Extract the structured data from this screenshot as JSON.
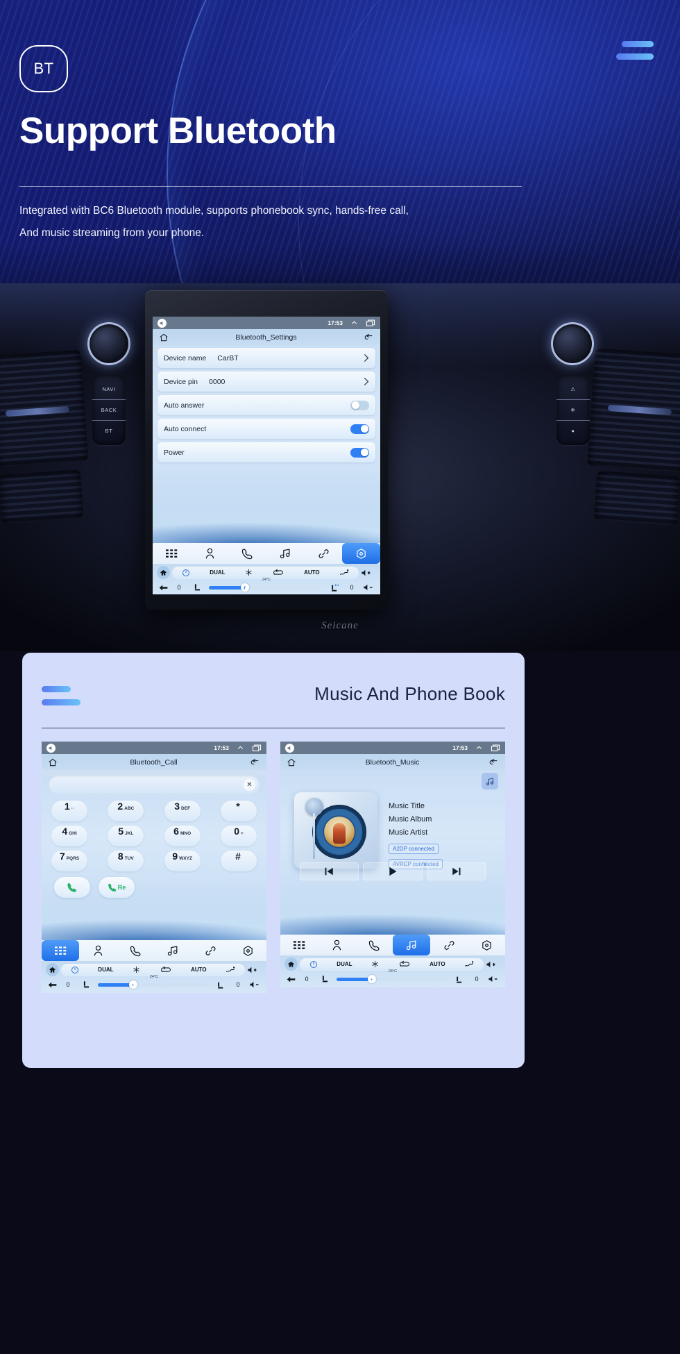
{
  "hero": {
    "badge": "BT",
    "title": "Support Bluetooth",
    "subtitle_line1": "Integrated with BC6 Bluetooth module, supports phonebook sync, hands-free call,",
    "subtitle_line2": "And music streaming from your phone.",
    "accent_from": "#5a7af0",
    "accent_to": "#69c2f7",
    "background": "#141b6e"
  },
  "dash": {
    "brand": "Seicane",
    "left_keys": [
      "NAVI",
      "BACK",
      "BT"
    ],
    "right_keys": [
      "⚠",
      "❄",
      "●"
    ]
  },
  "main_screen": {
    "statusbar": {
      "time": "17:53",
      "chevron_icon": "chevron-up-icon",
      "recents_icon": "recents-icon",
      "volume_icon": "volume-icon"
    },
    "titlebar": {
      "home_icon": "home-icon",
      "title": "Bluetooth_Settings",
      "back_icon": "back-arrow-icon"
    },
    "rows": [
      {
        "label": "Device name",
        "value": "CarBT",
        "control": "chevron"
      },
      {
        "label": "Device pin",
        "value": "0000",
        "control": "chevron"
      },
      {
        "label": "Auto answer",
        "value": "",
        "control": "toggle",
        "on": false
      },
      {
        "label": "Auto connect",
        "value": "",
        "control": "toggle",
        "on": true
      },
      {
        "label": "Power",
        "value": "",
        "control": "toggle",
        "on": true
      }
    ],
    "dock": [
      {
        "icon": "apps-grid-icon",
        "active": false
      },
      {
        "icon": "contact-icon",
        "active": false
      },
      {
        "icon": "phone-icon",
        "active": false
      },
      {
        "icon": "music-note-icon",
        "active": false
      },
      {
        "icon": "link-icon",
        "active": false
      },
      {
        "icon": "settings-icon",
        "active": true
      }
    ],
    "climate": {
      "home_icon": "home-icon",
      "power_icon": "power-icon",
      "dual_label": "DUAL",
      "snowflake_icon": "snowflake-icon",
      "recirculate_icon": "recirculate-icon",
      "auto_label": "AUTO",
      "defrost_icon": "defrost-icon",
      "volume_up_icon": "volume-up-icon",
      "back_icon": "back-arrow-icon",
      "left_temp": "0",
      "right_temp": "0",
      "center_temp": "24°C",
      "seat_icon": "seat-icon",
      "seat_heat_icon": "seat-heat-icon",
      "volume_down_icon": "volume-down-icon",
      "fan_percent": 30
    }
  },
  "panel": {
    "title": "Music And Phone Book",
    "call_screen": {
      "statusbar": {
        "time": "17:53"
      },
      "titlebar": {
        "home_icon": "home-icon",
        "title": "Bluetooth_Call",
        "back_icon": "back-arrow-icon"
      },
      "search_value": "",
      "search_placeholder": "",
      "clear_icon": "clear-icon",
      "keypad": [
        [
          {
            "num": "1",
            "sub": "··"
          },
          {
            "num": "2",
            "sub": "ABC"
          },
          {
            "num": "3",
            "sub": "DEF"
          },
          {
            "num": "*",
            "sub": ""
          }
        ],
        [
          {
            "num": "4",
            "sub": "GHI"
          },
          {
            "num": "5",
            "sub": "JKL"
          },
          {
            "num": "6",
            "sub": "MNO"
          },
          {
            "num": "0",
            "sub": "+"
          }
        ],
        [
          {
            "num": "7",
            "sub": "PQRS"
          },
          {
            "num": "8",
            "sub": "TUV"
          },
          {
            "num": "9",
            "sub": "WXYZ"
          },
          {
            "num": "#",
            "sub": ""
          }
        ]
      ],
      "call_button": {
        "icon": "phone-call-icon",
        "label": ""
      },
      "redial_button": {
        "icon": "phone-call-icon",
        "label": "Re"
      },
      "dock": [
        {
          "icon": "apps-grid-icon",
          "active": true
        },
        {
          "icon": "contact-icon",
          "active": false
        },
        {
          "icon": "phone-icon",
          "active": false
        },
        {
          "icon": "music-note-icon",
          "active": false
        },
        {
          "icon": "link-icon",
          "active": false
        },
        {
          "icon": "settings-icon",
          "active": false
        }
      ]
    },
    "music_screen": {
      "statusbar": {
        "time": "17:53"
      },
      "titlebar": {
        "home_icon": "home-icon",
        "title": "Bluetooth_Music",
        "back_icon": "back-arrow-icon"
      },
      "note_button_icon": "music-note-icon",
      "meta": {
        "title": "Music Title",
        "album": "Music Album",
        "artist": "Music Artist",
        "badge_a2dp": "A2DP  connected",
        "badge_avrcp": "AVRCP connected"
      },
      "transport": [
        {
          "icon": "previous-track-icon"
        },
        {
          "icon": "play-icon"
        },
        {
          "icon": "next-track-icon"
        }
      ],
      "dock": [
        {
          "icon": "apps-grid-icon",
          "active": false
        },
        {
          "icon": "contact-icon",
          "active": false
        },
        {
          "icon": "phone-icon",
          "active": false
        },
        {
          "icon": "music-note-icon",
          "active": true
        },
        {
          "icon": "link-icon",
          "active": false
        },
        {
          "icon": "settings-icon",
          "active": false
        }
      ]
    },
    "climate": {
      "dual_label": "DUAL",
      "auto_label": "AUTO",
      "left_temp": "0",
      "right_temp": "0",
      "center_temp": "24°C"
    }
  }
}
